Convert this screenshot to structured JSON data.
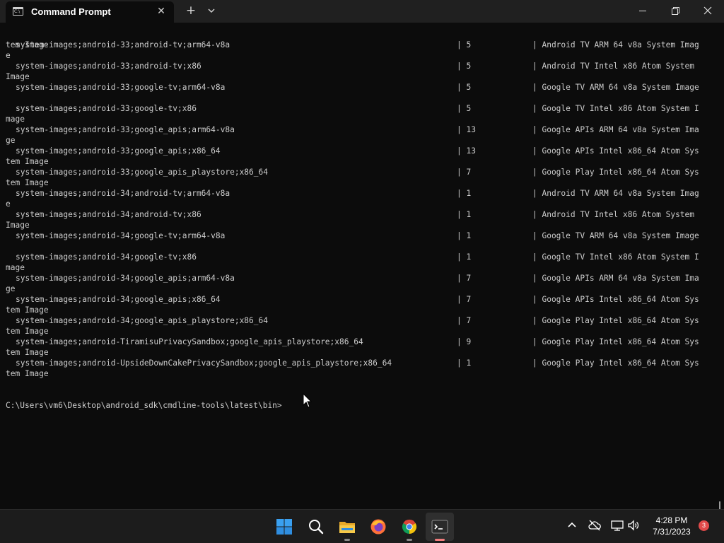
{
  "window": {
    "tab_title": "Command Prompt",
    "tab_icon_glyph": "C:\\",
    "new_tab_glyph": "+",
    "close_tab_glyph": "✕"
  },
  "terminal": {
    "first_line": "tem Image",
    "rows": [
      {
        "pkg": "system-images;android-33;android-tv;arm64-v8a",
        "ver": "| 5",
        "desc": "| Android TV ARM 64 v8a System Imag",
        "wrap": "e"
      },
      {
        "pkg": "system-images;android-33;android-tv;x86",
        "ver": "| 5",
        "desc": "| Android TV Intel x86 Atom System",
        "wrap": "Image"
      },
      {
        "pkg": "system-images;android-33;google-tv;arm64-v8a",
        "ver": "| 5",
        "desc": "| Google TV ARM 64 v8a System Image",
        "wrap": ""
      },
      {
        "pkg": "system-images;android-33;google-tv;x86",
        "ver": "| 5",
        "desc": "| Google TV Intel x86 Atom System I",
        "wrap": "mage"
      },
      {
        "pkg": "system-images;android-33;google_apis;arm64-v8a",
        "ver": "| 13",
        "desc": "| Google APIs ARM 64 v8a System Ima",
        "wrap": "ge"
      },
      {
        "pkg": "system-images;android-33;google_apis;x86_64",
        "ver": "| 13",
        "desc": "| Google APIs Intel x86_64 Atom Sys",
        "wrap": "tem Image"
      },
      {
        "pkg": "system-images;android-33;google_apis_playstore;x86_64",
        "ver": "| 7",
        "desc": "| Google Play Intel x86_64 Atom Sys",
        "wrap": "tem Image"
      },
      {
        "pkg": "system-images;android-34;android-tv;arm64-v8a",
        "ver": "| 1",
        "desc": "| Android TV ARM 64 v8a System Imag",
        "wrap": "e"
      },
      {
        "pkg": "system-images;android-34;android-tv;x86",
        "ver": "| 1",
        "desc": "| Android TV Intel x86 Atom System",
        "wrap": "Image"
      },
      {
        "pkg": "system-images;android-34;google-tv;arm64-v8a",
        "ver": "| 1",
        "desc": "| Google TV ARM 64 v8a System Image",
        "wrap": ""
      },
      {
        "pkg": "system-images;android-34;google-tv;x86",
        "ver": "| 1",
        "desc": "| Google TV Intel x86 Atom System I",
        "wrap": "mage"
      },
      {
        "pkg": "system-images;android-34;google_apis;arm64-v8a",
        "ver": "| 7",
        "desc": "| Google APIs ARM 64 v8a System Ima",
        "wrap": "ge"
      },
      {
        "pkg": "system-images;android-34;google_apis;x86_64",
        "ver": "| 7",
        "desc": "| Google APIs Intel x86_64 Atom Sys",
        "wrap": "tem Image"
      },
      {
        "pkg": "system-images;android-34;google_apis_playstore;x86_64",
        "ver": "| 7",
        "desc": "| Google Play Intel x86_64 Atom Sys",
        "wrap": "tem Image"
      },
      {
        "pkg": "system-images;android-TiramisuPrivacySandbox;google_apis_playstore;x86_64",
        "ver": "| 9",
        "desc": "| Google Play Intel x86_64 Atom Sys",
        "wrap": "tem Image"
      },
      {
        "pkg": "system-images;android-UpsideDownCakePrivacySandbox;google_apis_playstore;x86_64",
        "ver": "| 1",
        "desc": "| Google Play Intel x86_64 Atom Sys",
        "wrap": "tem Image"
      }
    ],
    "prompt": "C:\\Users\\vm6\\Desktop\\android_sdk\\cmdline-tools\\latest\\bin>"
  },
  "taskbar": {
    "apps": [
      {
        "name": "start-icon",
        "active": false,
        "running": false
      },
      {
        "name": "search-icon",
        "active": false,
        "running": false
      },
      {
        "name": "file-explorer-icon",
        "active": false,
        "running": true
      },
      {
        "name": "firefox-icon",
        "active": false,
        "running": false
      },
      {
        "name": "chrome-icon",
        "active": false,
        "running": true
      },
      {
        "name": "terminal-icon",
        "active": true,
        "running": true
      }
    ],
    "tray_icons": [
      "chevron-up-icon",
      "cloud-offline-icon",
      "network-icon",
      "volume-icon"
    ],
    "time": "4:28 PM",
    "date": "7/31/2023",
    "notification_count": "3"
  },
  "colors": {
    "terminal_bg": "#0c0c0c",
    "terminal_text": "#cccccc",
    "titlebar_bg": "#202020",
    "taskbar_bg": "#1c1c1c",
    "active_indicator": "#f27d7d",
    "badge": "#e04a4a"
  }
}
